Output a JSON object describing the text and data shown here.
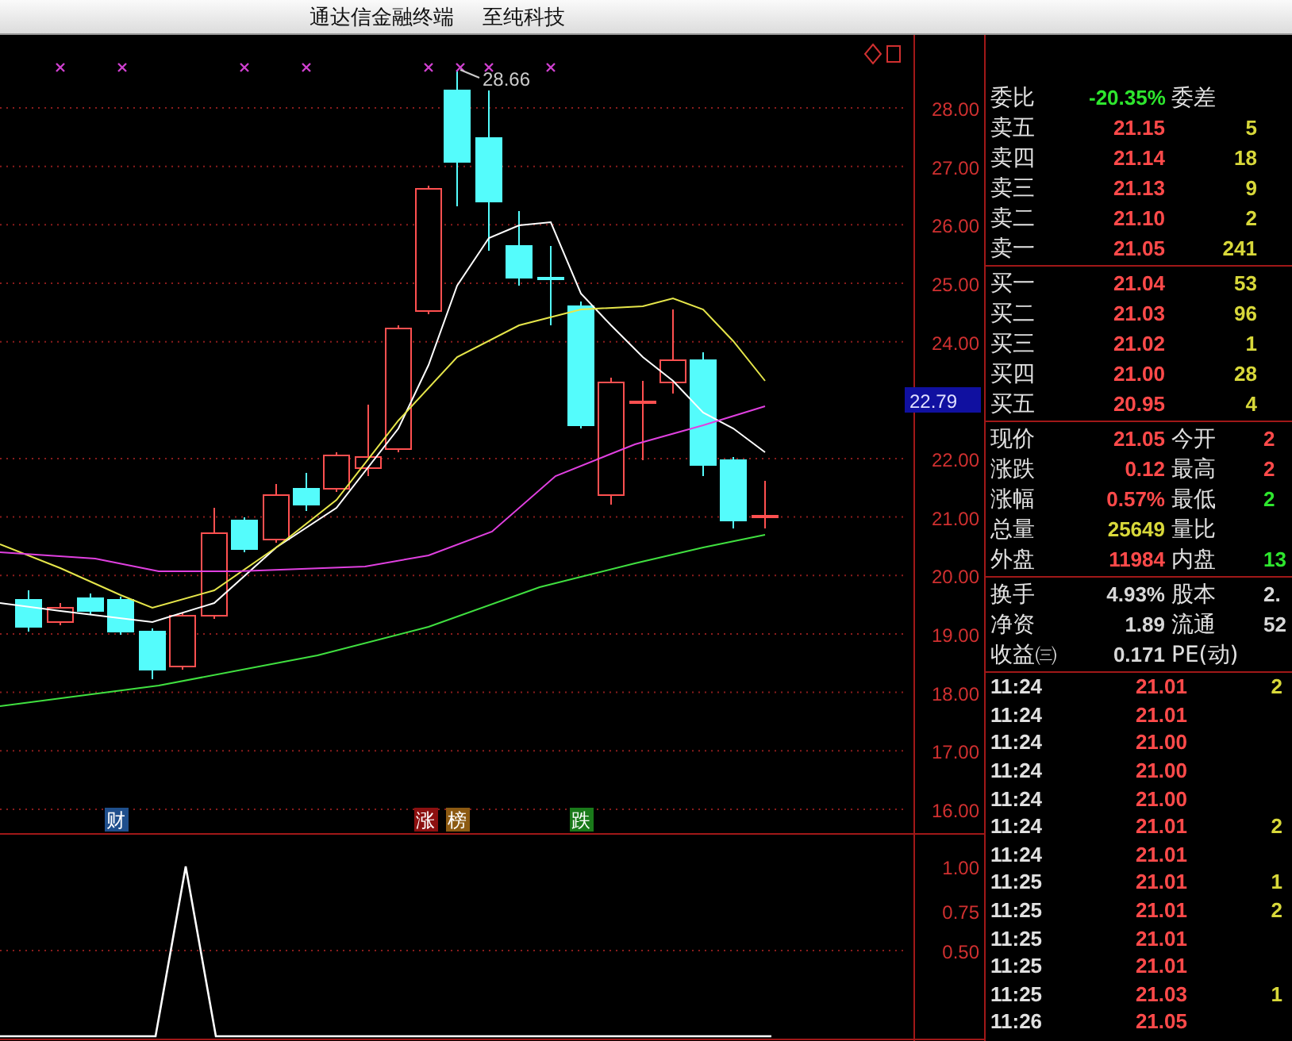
{
  "window": {
    "title": "通达信金融终端",
    "subtitle": "至纯科技"
  },
  "price_chart": {
    "axis_labels": [
      "28.00",
      "27.00",
      "26.00",
      "25.00",
      "24.00",
      "22.00",
      "21.00",
      "20.00",
      "19.00",
      "18.00",
      "17.00",
      "16.00"
    ],
    "high_label": "28.66",
    "current_price": "22.79",
    "events": [
      {
        "label": "财",
        "color": "#1f4f8c"
      },
      {
        "label": "涨",
        "color": "#8c1010"
      },
      {
        "label": "榜",
        "color": "#8c5a12"
      },
      {
        "label": "跌",
        "color": "#1a7a1a"
      }
    ]
  },
  "indicator_chart": {
    "axis_labels": [
      "1.00",
      "0.75",
      "0.50"
    ]
  },
  "order_ratio": {
    "label": "委比",
    "value": "-20.35%",
    "label2": "委差"
  },
  "asks": [
    {
      "label": "卖五",
      "price": "21.15",
      "volume": "5"
    },
    {
      "label": "卖四",
      "price": "21.14",
      "volume": "18"
    },
    {
      "label": "卖三",
      "price": "21.13",
      "volume": "9"
    },
    {
      "label": "卖二",
      "price": "21.10",
      "volume": "2"
    },
    {
      "label": "卖一",
      "price": "21.05",
      "volume": "241"
    }
  ],
  "bids": [
    {
      "label": "买一",
      "price": "21.04",
      "volume": "53"
    },
    {
      "label": "买二",
      "price": "21.03",
      "volume": "96"
    },
    {
      "label": "买三",
      "price": "21.02",
      "volume": "1"
    },
    {
      "label": "买四",
      "price": "21.00",
      "volume": "28"
    },
    {
      "label": "买五",
      "price": "20.95",
      "volume": "4"
    }
  ],
  "quote": [
    {
      "left": {
        "label": "现价",
        "value": "21.05",
        "color": "#ff4a4a"
      },
      "right": {
        "label": "今开",
        "value": "2",
        "color": "#ff4a4a"
      }
    },
    {
      "left": {
        "label": "涨跌",
        "value": "0.12",
        "color": "#ff4a4a"
      },
      "right": {
        "label": "最高",
        "value": "2",
        "color": "#ff4a4a"
      }
    },
    {
      "left": {
        "label": "涨幅",
        "value": "0.57%",
        "color": "#ff4a4a"
      },
      "right": {
        "label": "最低",
        "value": "2",
        "color": "#2ee62e"
      }
    },
    {
      "left": {
        "label": "总量",
        "value": "25649",
        "color": "#d8d83a"
      },
      "right": {
        "label": "量比"
      }
    },
    {
      "left": {
        "label": "外盘",
        "value": "11984",
        "color": "#ff4a4a"
      },
      "right": {
        "label": "内盘",
        "value": "13",
        "color": "#2ee62e"
      }
    }
  ],
  "stats": [
    {
      "left": {
        "label": "换手",
        "value": "4.93%",
        "color": "#d8d8d8"
      },
      "right": {
        "label": "股本",
        "value": "2.",
        "color": "#d8d8d8"
      }
    },
    {
      "left": {
        "label": "净资",
        "value": "1.89",
        "color": "#d8d8d8"
      },
      "right": {
        "label": "流通",
        "value": "52",
        "color": "#d8d8d8"
      }
    },
    {
      "left": {
        "label": "收益㈢",
        "value": "0.171",
        "color": "#d8d8d8"
      },
      "right": {
        "label": "PE(动)"
      }
    }
  ],
  "ticks": [
    {
      "time": "11:24",
      "price": "21.01",
      "volume": "2"
    },
    {
      "time": "11:24",
      "price": "21.01"
    },
    {
      "time": "11:24",
      "price": "21.00"
    },
    {
      "time": "11:24",
      "price": "21.00"
    },
    {
      "time": "11:24",
      "price": "21.00"
    },
    {
      "time": "11:24",
      "price": "21.01",
      "volume": "2"
    },
    {
      "time": "11:24",
      "price": "21.01"
    },
    {
      "time": "11:25",
      "price": "21.01",
      "volume": "1"
    },
    {
      "time": "11:25",
      "price": "21.01",
      "volume": "2"
    },
    {
      "time": "11:25",
      "price": "21.01"
    },
    {
      "time": "11:25",
      "price": "21.01"
    },
    {
      "time": "11:25",
      "price": "21.03",
      "volume": "1"
    },
    {
      "time": "11:26",
      "price": "21.05"
    }
  ]
}
